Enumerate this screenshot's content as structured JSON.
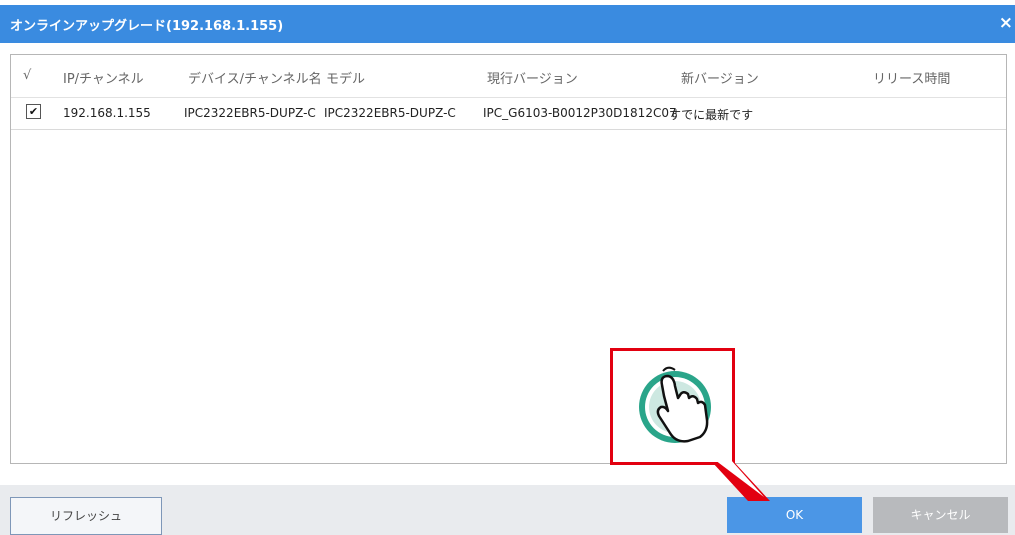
{
  "window": {
    "title": "オンラインアップグレード(192.168.1.155)",
    "close_label": "×"
  },
  "table": {
    "columns": [
      "√",
      "IP/チャンネル",
      "デバイス/チャンネル名",
      "モデル",
      "現行バージョン",
      "新バージョン",
      "リリース時間"
    ],
    "rows": [
      {
        "checked": "✔",
        "ip": "192.168.1.155",
        "device_name": "IPC2322EBR5-DUPZ-C",
        "model": "IPC2322EBR5-DUPZ-C",
        "current_version": "IPC_G6103-B0012P30D1812C07",
        "new_version": "すでに最新です",
        "release_time": ""
      }
    ]
  },
  "buttons": {
    "refresh": "リフレッシュ",
    "ok": "OK",
    "cancel": "キャンセル"
  },
  "colors": {
    "titlebar": "#3a8be0",
    "ok_button": "#4b96e6",
    "cancel_button": "#b8babd",
    "annotation": "#e20010",
    "cursor_ring": "#2aa58a"
  },
  "icons": {
    "pointer": "hand-pointer-icon"
  }
}
